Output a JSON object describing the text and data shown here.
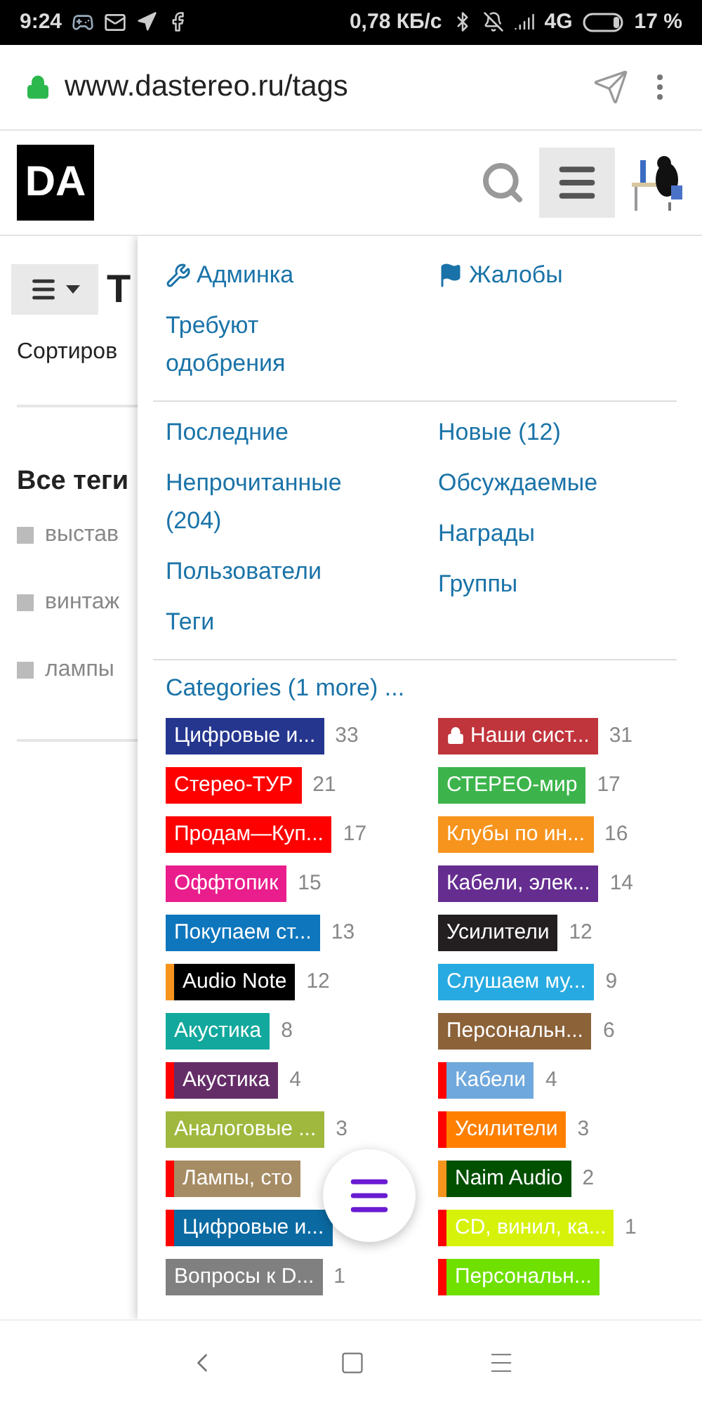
{
  "status_bar": {
    "time": "9:24",
    "speed": "0,78 КБ/с",
    "network": "4G",
    "battery": "17 %"
  },
  "browser": {
    "url": "www.dastereo.ru/tags"
  },
  "header": {
    "logo": "DA"
  },
  "page": {
    "title": "Т",
    "sort_label": "Сортиров",
    "section_title": "Все теги",
    "tags": [
      "выстав",
      "винтаж",
      "лампы"
    ]
  },
  "menu": {
    "sections": [
      {
        "left": [
          {
            "label": "Админка",
            "kind": "icon-link"
          },
          {
            "label": "Требуют одобрения",
            "kind": "link"
          }
        ],
        "right": [
          {
            "label": "Жалобы",
            "kind": "icon-link"
          }
        ]
      },
      {
        "left": [
          {
            "label": "Последние",
            "kind": "link"
          },
          {
            "label": "Непрочитанные (204)",
            "kind": "link"
          },
          {
            "label": "Пользователи",
            "kind": "link"
          },
          {
            "label": "Теги",
            "kind": "link"
          }
        ],
        "right": [
          {
            "label": "Новые (12)",
            "kind": "link"
          },
          {
            "label": "Обсуждаемые",
            "kind": "link"
          },
          {
            "label": "Награды",
            "kind": "link"
          },
          {
            "label": "Группы",
            "kind": "link"
          }
        ]
      }
    ],
    "categories_link": "Categories (1 more) ...",
    "categories": [
      {
        "label": "Цифровые и...",
        "count": "33",
        "color": "#25368f",
        "locked": false
      },
      {
        "label": "Наши сист...",
        "count": "31",
        "color": "#c0343b",
        "locked": true
      },
      {
        "label": "Стерео-ТУР",
        "count": "21",
        "color": "#ff0000",
        "locked": false
      },
      {
        "label": "СТЕРЕО-мир",
        "count": "17",
        "color": "#3cb44b",
        "locked": false
      },
      {
        "label": "Продам—Куп...",
        "count": "17",
        "color": "#ff0000",
        "locked": false
      },
      {
        "label": "Клубы по ин...",
        "count": "16",
        "color": "#f7941d",
        "locked": false
      },
      {
        "label": "Оффтопик",
        "count": "15",
        "color": "#e91e8c",
        "locked": false
      },
      {
        "label": "Кабели, элек...",
        "count": "14",
        "color": "#652d90",
        "locked": false
      },
      {
        "label": "Покупаем ст...",
        "count": "13",
        "color": "#0e76bd",
        "locked": false
      },
      {
        "label": "Усилители",
        "count": "12",
        "color": "#231f20",
        "locked": false
      },
      {
        "label": "Audio Note",
        "count": "12",
        "color": "#000000",
        "parent": {
          "color": "#f7941d"
        },
        "locked": false
      },
      {
        "label": "Слушаем му...",
        "count": "9",
        "color": "#27aae1",
        "locked": false
      },
      {
        "label": "Акустика",
        "count": "8",
        "color": "#12a89d",
        "locked": false
      },
      {
        "label": "Персональн...",
        "count": "6",
        "color": "#8c6239",
        "locked": false
      },
      {
        "label": "Акустика",
        "count": "4",
        "color": "#652d68",
        "parent": {
          "color": "#ff0000"
        },
        "locked": false
      },
      {
        "label": "Кабели",
        "count": "4",
        "color": "#6fa8dc",
        "parent": {
          "color": "#ff0000"
        },
        "locked": false
      },
      {
        "label": "Аналоговые ...",
        "count": "3",
        "color": "#9fb83d",
        "locked": false
      },
      {
        "label": "Усилители",
        "count": "3",
        "color": "#ff8000",
        "parent": {
          "color": "#ff0000"
        },
        "locked": false
      },
      {
        "label": "Лампы, сто",
        "color": "#a68c64",
        "parent": {
          "color": "#ff0000"
        },
        "locked": false
      },
      {
        "label": "Naim Audio",
        "count": "2",
        "color": "#005000",
        "parent": {
          "color": "#f7941d"
        },
        "locked": false
      },
      {
        "label": "Цифровые и...",
        "color": "#0b6aa2",
        "parent": {
          "color": "#ff0000"
        },
        "locked": false
      },
      {
        "label": "CD, винил, ка...",
        "count": "1",
        "color": "#d6f20a",
        "parent": {
          "color": "#ff0000"
        },
        "locked": false
      },
      {
        "label": "Вопросы к D...",
        "count": "1",
        "color": "#808080",
        "locked": false
      },
      {
        "label": "Персональн...",
        "color": "#6fe000",
        "parent": {
          "color": "#ff0000"
        },
        "locked": false
      }
    ]
  }
}
